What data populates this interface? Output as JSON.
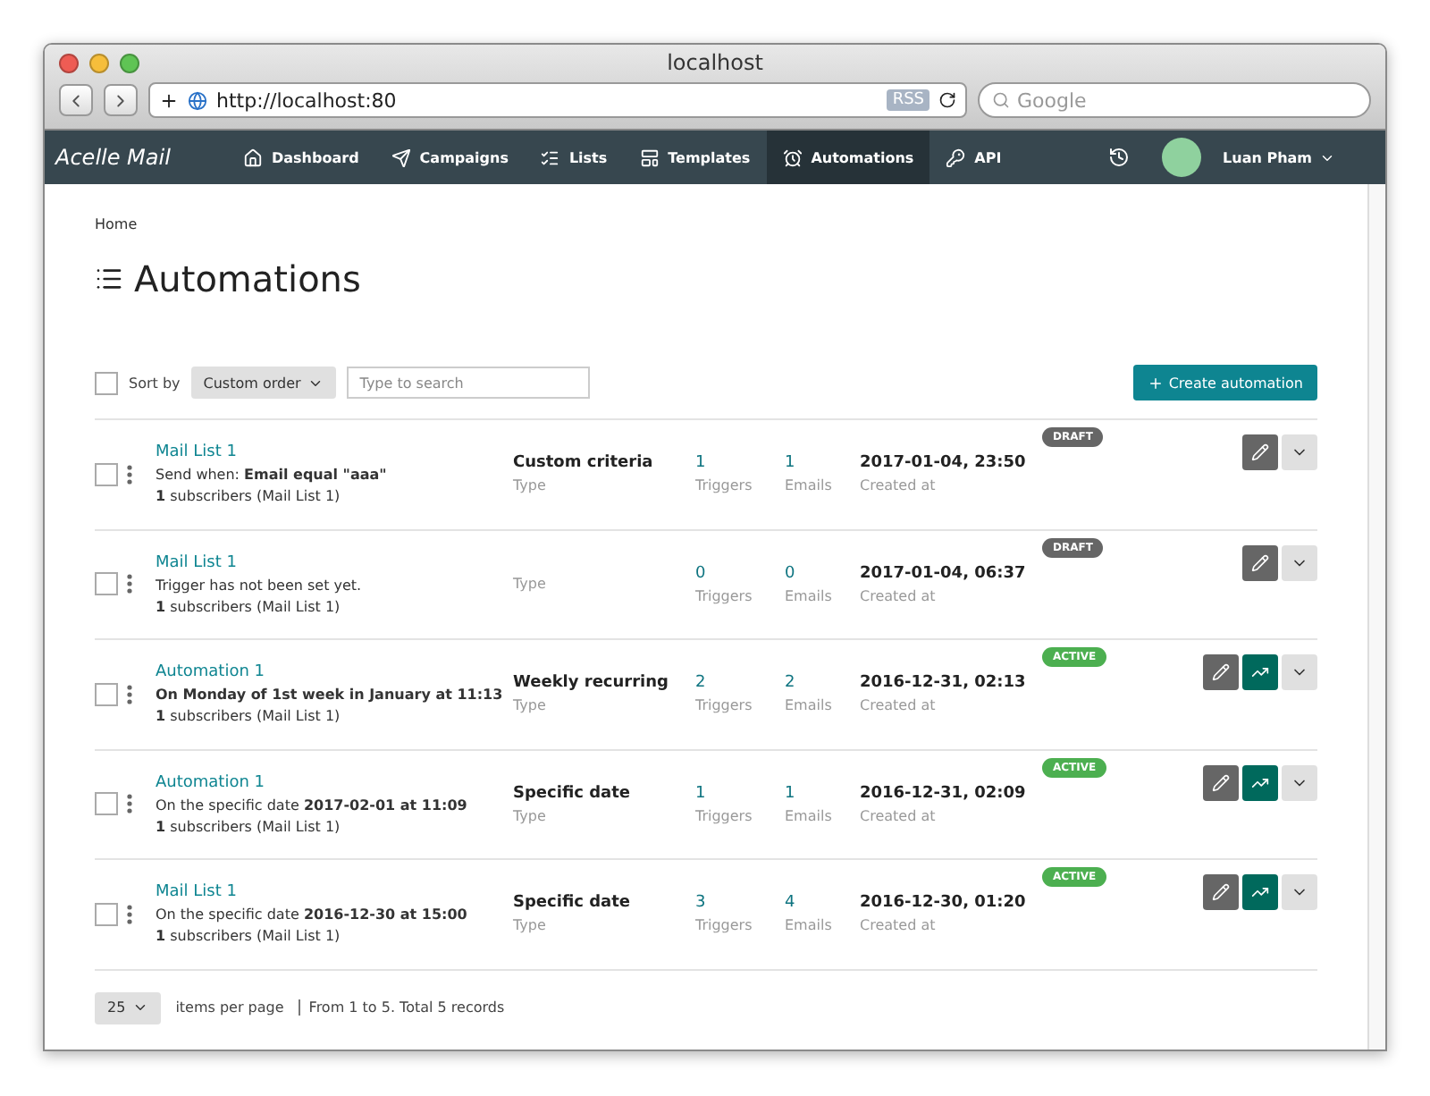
{
  "window": {
    "title": "localhost"
  },
  "browser": {
    "url": "http://localhost:80",
    "rss": "RSS",
    "search_placeholder": "Google"
  },
  "nav": {
    "logo": "Acelle Mail",
    "items": [
      {
        "label": "Dashboard",
        "selected": false
      },
      {
        "label": "Campaigns",
        "selected": false
      },
      {
        "label": "Lists",
        "selected": false
      },
      {
        "label": "Templates",
        "selected": false
      },
      {
        "label": "Automations",
        "selected": true
      },
      {
        "label": "API",
        "selected": false
      }
    ],
    "user": "Luan Pham"
  },
  "breadcrumb": "Home",
  "page_title": "Automations",
  "toolbar": {
    "select_all_checked": false,
    "sort_label": "Sort by",
    "sort_value": "Custom order",
    "search_placeholder": "Type to search",
    "create_button": "Create automation"
  },
  "rows": [
    {
      "checked": false,
      "name": "Mail List 1",
      "description": "Send when: **Email equal \"aaa\"**",
      "subscribers": "**1** subscribers (Mail List 1)",
      "type": "Custom criteria",
      "type_label": "Type",
      "triggers": "1",
      "triggers_label": "Triggers",
      "emails": "1",
      "emails_label": "Emails",
      "date": "2017-01-04, 23:50",
      "date_label": "Created at",
      "status": {
        "label": "DRAFT",
        "kind": "draft"
      },
      "stats_button": false
    },
    {
      "checked": false,
      "name": "Mail List 1",
      "description": "Trigger has not been set yet.",
      "subscribers": "**1** subscribers (Mail List 1)",
      "type_label": "Type",
      "triggers": "0",
      "triggers_label": "Triggers",
      "emails": "0",
      "emails_label": "Emails",
      "date": "2017-01-04, 06:37",
      "date_label": "Created at",
      "status": {
        "label": "DRAFT",
        "kind": "draft"
      },
      "stats_button": false
    },
    {
      "checked": false,
      "name": "Automation 1",
      "description": "**On Monday of 1st week in January at 11:13**",
      "subscribers": "**1** subscribers (Mail List 1)",
      "type": "Weekly recurring",
      "type_label": "Type",
      "triggers": "2",
      "triggers_label": "Triggers",
      "emails": "2",
      "emails_label": "Emails",
      "date": "2016-12-31, 02:13",
      "date_label": "Created at",
      "status": {
        "label": "ACTIVE",
        "kind": "active"
      },
      "stats_button": true
    },
    {
      "checked": false,
      "name": "Automation 1",
      "description": "On the specific date **2017-02-01 at 11:09**",
      "subscribers": "**1** subscribers (Mail List 1)",
      "type": "Specific date",
      "type_label": "Type",
      "triggers": "1",
      "triggers_label": "Triggers",
      "emails": "1",
      "emails_label": "Emails",
      "date": "2016-12-31, 02:09",
      "date_label": "Created at",
      "status": {
        "label": "ACTIVE",
        "kind": "active"
      },
      "stats_button": true
    },
    {
      "checked": false,
      "name": "Mail List 1",
      "description": "On the specific date **2016-12-30 at 15:00**",
      "subscribers": "**1** subscribers (Mail List 1)",
      "type": "Specific date",
      "type_label": "Type",
      "triggers": "3",
      "triggers_label": "Triggers",
      "emails": "4",
      "emails_label": "Emails",
      "date": "2016-12-30, 01:20",
      "date_label": "Created at",
      "status": {
        "label": "ACTIVE",
        "kind": "active"
      },
      "stats_button": true
    }
  ],
  "pagination": {
    "per_page": "25",
    "per_page_label": "items per page",
    "summary": "From 1 to 5. Total 5 records"
  }
}
